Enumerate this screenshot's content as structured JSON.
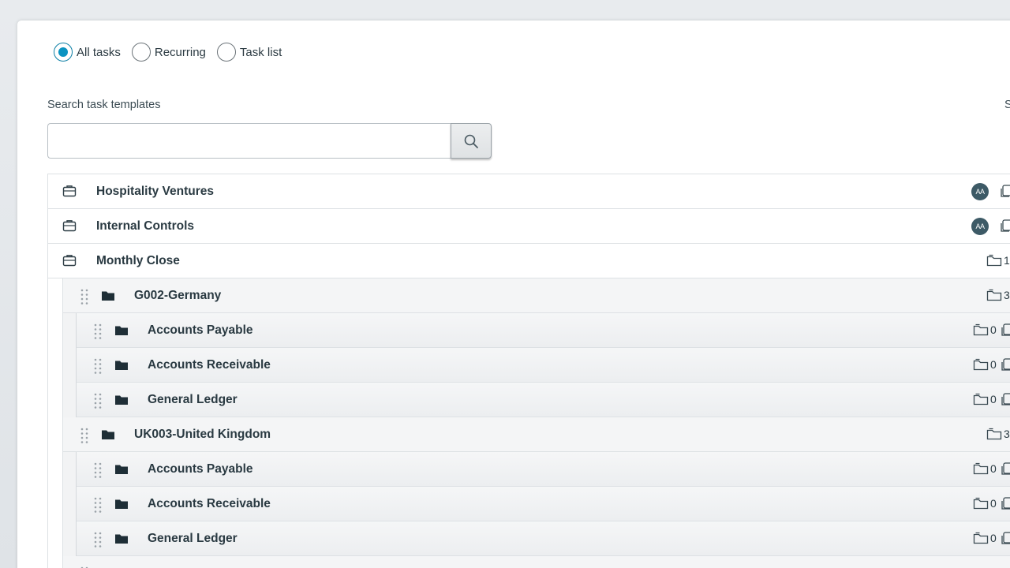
{
  "filters": {
    "options": [
      {
        "label": "All tasks",
        "checked": true
      },
      {
        "label": "Recurring",
        "checked": false
      },
      {
        "label": "Task list",
        "checked": false
      }
    ]
  },
  "search": {
    "label": "Search task templates",
    "value": "",
    "placeholder": "",
    "right_label_cut": "S"
  },
  "tree": {
    "top_items": [
      {
        "label": "Hospitality Ventures",
        "avatar": "AA"
      },
      {
        "label": "Internal Controls",
        "avatar": "AA"
      },
      {
        "label": "Monthly Close",
        "count": "1"
      }
    ],
    "groups": [
      {
        "label": "G002-Germany",
        "count": "3",
        "children": [
          {
            "label": "Accounts Payable",
            "count": "0"
          },
          {
            "label": "Accounts Receivable",
            "count": "0"
          },
          {
            "label": "General Ledger",
            "count": "0"
          }
        ]
      },
      {
        "label": "UK003-United Kingdom",
        "count": "3",
        "children": [
          {
            "label": "Accounts Payable",
            "count": "0"
          },
          {
            "label": "Accounts Receivable",
            "count": "0"
          },
          {
            "label": "General Ledger",
            "count": "0"
          }
        ]
      }
    ]
  },
  "icons": {
    "briefcase": "briefcase-icon",
    "folder": "folder-icon",
    "drag": "drag-handle-icon",
    "search": "search-icon",
    "copy": "copy-icon"
  },
  "colors": {
    "accent": "#0a93c1",
    "avatar": "#3d5a66"
  }
}
